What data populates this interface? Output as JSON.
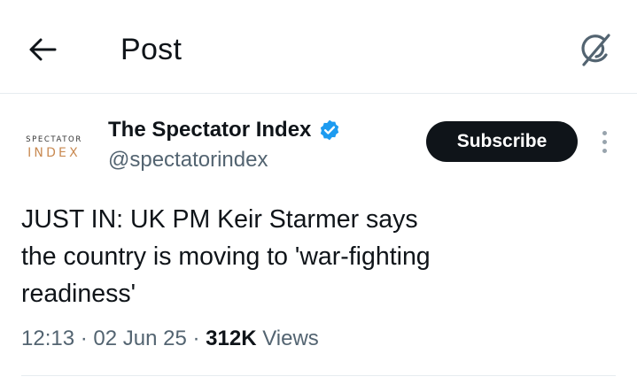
{
  "header": {
    "title": "Post",
    "back_icon": "arrow-left-icon",
    "grok_icon": "grok-icon"
  },
  "author": {
    "logo_top": "SPECTATOR",
    "logo_bottom": "INDEX",
    "display_name": "The Spectator Index",
    "handle": "@spectatorindex",
    "verified": true,
    "verified_color": "#1d9bf0"
  },
  "actions": {
    "subscribe_label": "Subscribe",
    "more_icon": "more-vertical-icon"
  },
  "post": {
    "text": "JUST IN: UK PM Keir Starmer says\nthe country is moving to 'war-fighting\nreadiness'",
    "time": "12:13",
    "separator": "·",
    "date": "02 Jun 25",
    "views_count": "312K",
    "views_label": "Views"
  },
  "colors": {
    "text_primary": "#0f1419",
    "text_secondary": "#536471",
    "logo_accent": "#c98a52",
    "divider": "#e6ecf0"
  }
}
